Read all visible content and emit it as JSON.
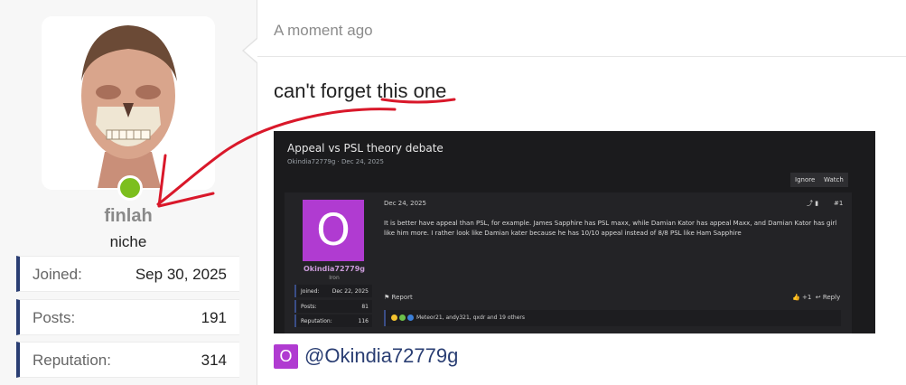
{
  "user": {
    "username": "finlah",
    "title": "niche",
    "online": true,
    "stats": [
      {
        "label": "Joined:",
        "value": "Sep 30, 2025"
      },
      {
        "label": "Posts:",
        "value": "191"
      },
      {
        "label": "Reputation:",
        "value": "314"
      }
    ]
  },
  "post": {
    "time": "A moment ago",
    "message": "can't forget this one",
    "mention": {
      "initial": "O",
      "name": "@Okindia72779g"
    }
  },
  "embedded": {
    "thread_title": "Appeal vs PSL theory debate",
    "meta": "Okindia72779g · Dec 24, 2025",
    "ignore": "Ignore",
    "watch": "Watch",
    "author": {
      "initial": "O",
      "name": "Okindia72779g",
      "rank": "Iron"
    },
    "author_stats": [
      {
        "label": "Joined:",
        "value": "Dec 22, 2025"
      },
      {
        "label": "Posts:",
        "value": "81"
      },
      {
        "label": "Reputation:",
        "value": "116"
      }
    ],
    "date": "Dec 24, 2025",
    "number": "#1",
    "body": "It is better have appeal than PSL, for example. James Sapphire has PSL maxx, while Damian Kator has appeal Maxx, and Damian Kator has girl like him more. I rather look like Damian kater because he has 10/10 appeal instead of 8/8 PSL like Ham Sapphire",
    "report": "Report",
    "like": "+1",
    "reply": "Reply",
    "reactions": "Meteor21, andy321, qxdr and 19 others"
  },
  "colors": {
    "accent": "#2a3e73",
    "online": "#7cbf1e",
    "annotation": "#d9182a",
    "avatar_purple": "#b03bd1"
  }
}
